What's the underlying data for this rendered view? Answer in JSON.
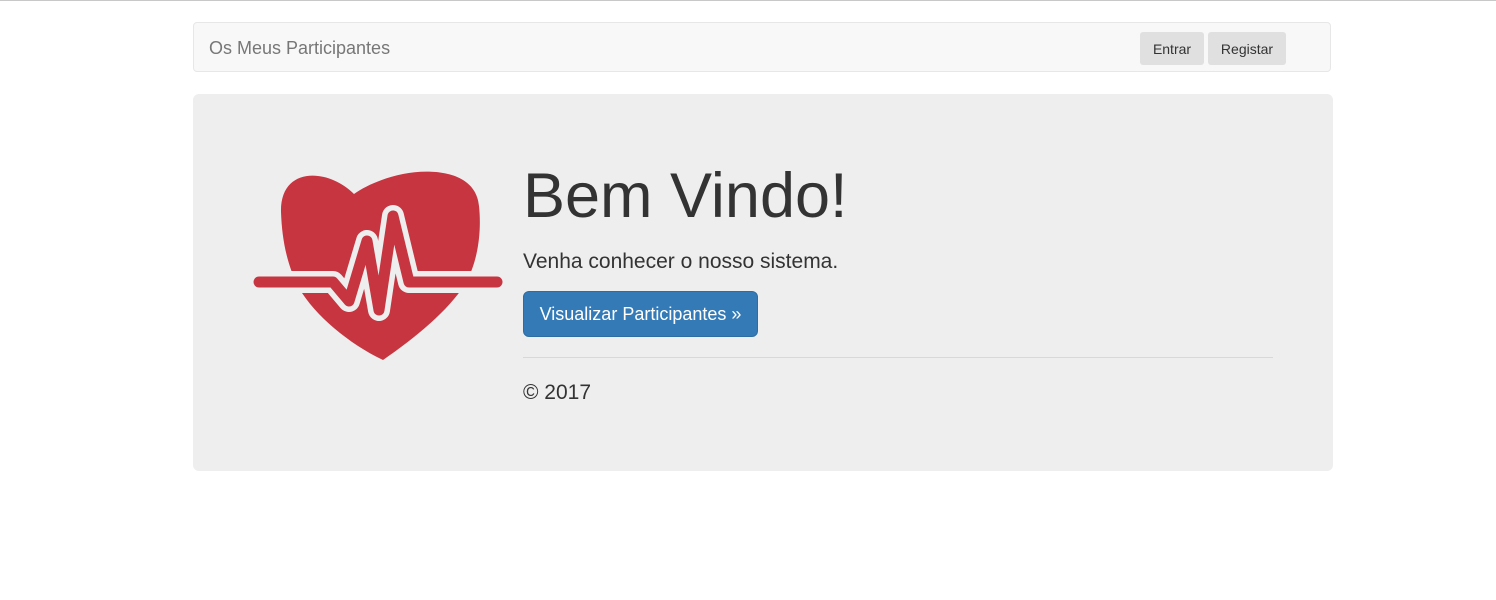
{
  "navbar": {
    "brand": "Os Meus Participantes",
    "login_label": "Entrar",
    "register_label": "Registar"
  },
  "jumbotron": {
    "logo_icon": "heartbeat-icon",
    "logo_color": "#c63540",
    "title": "Bem Vindo!",
    "lead": "Venha conhecer o nosso sistema.",
    "button_label": "Visualizar Participantes »",
    "button_color": "#337ab7",
    "footer": "© 2017"
  }
}
